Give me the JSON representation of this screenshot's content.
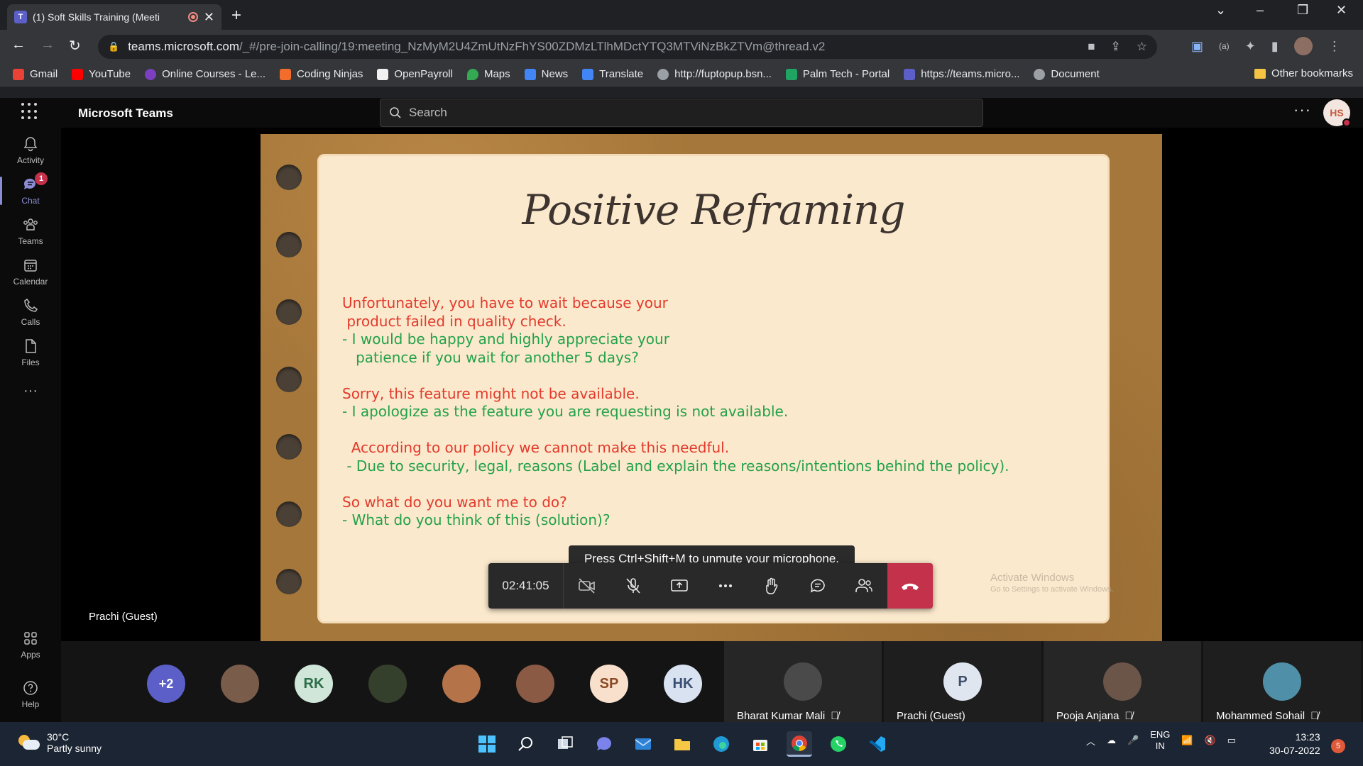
{
  "browser": {
    "tab_title": "(1) Soft Skills Training (Meeti",
    "url_host": "teams.microsoft.com",
    "url_path": "/_#/pre-join-calling/19:meeting_NzMyM2U4ZmUtNzFhYS00ZDMzLTlhMDctYTQ3MTViNzBkZTVm@thread.v2",
    "bookmarks": [
      "Gmail",
      "YouTube",
      "Online Courses - Le...",
      "Coding Ninjas",
      "OpenPayroll",
      "Maps",
      "News",
      "Translate",
      "http://fuptopup.bsn...",
      "Palm Tech - Portal",
      "https://teams.micro...",
      "Document"
    ],
    "other_bookmarks": "Other bookmarks"
  },
  "teams": {
    "app_title": "Microsoft Teams",
    "search_placeholder": "Search",
    "user_initials": "HS",
    "rail": [
      {
        "label": "Activity"
      },
      {
        "label": "Chat",
        "badge": "1"
      },
      {
        "label": "Teams"
      },
      {
        "label": "Calendar"
      },
      {
        "label": "Calls"
      },
      {
        "label": "Files"
      },
      {
        "label": "Apps"
      },
      {
        "label": "Help"
      }
    ]
  },
  "slide": {
    "title": "Positive Reframing",
    "lines": [
      {
        "text": "Unfortunately, you have to wait because your",
        "color": "red"
      },
      {
        "text": " product failed in quality check.",
        "color": "red"
      },
      {
        "text": "- I would be happy and highly appreciate your",
        "color": "green"
      },
      {
        "text": "   patience if you wait for another 5 days?",
        "color": "green"
      },
      {
        "text": "",
        "color": "red"
      },
      {
        "text": "Sorry, this feature might not be available.",
        "color": "red"
      },
      {
        "text": "- I apologize as the feature you are requesting is not available.",
        "color": "green"
      },
      {
        "text": "",
        "color": "red"
      },
      {
        "text": "  According to our policy we cannot make this needful.",
        "color": "red"
      },
      {
        "text": " - Due to security, legal, reasons (Label and explain the reasons/intentions behind the policy).",
        "color": "green"
      },
      {
        "text": "",
        "color": "red"
      },
      {
        "text": "So what do you want me to do?",
        "color": "red"
      },
      {
        "text": "- What do you think of this (solution)?",
        "color": "green"
      }
    ],
    "watermark_title": "Activate Windows",
    "watermark_sub": "Go to Settings to activate Windows."
  },
  "call": {
    "tooltip": "Press Ctrl+Shift+M to unmute your microphone.",
    "timer": "02:41:05",
    "presenter_label": "Prachi (Guest)"
  },
  "participants": {
    "overflow": "+2",
    "avatars": [
      {
        "initials": "",
        "kind": "photo"
      },
      {
        "initials": "RK",
        "kind": "initials"
      },
      {
        "initials": "",
        "kind": "photo"
      },
      {
        "initials": "",
        "kind": "photo"
      },
      {
        "initials": "",
        "kind": "photo"
      },
      {
        "initials": "SP",
        "kind": "initials"
      },
      {
        "initials": "HK",
        "kind": "initials"
      }
    ],
    "tiles": [
      {
        "name": "Bharat Kumar Mali",
        "initials": "",
        "muted": true
      },
      {
        "name": "Prachi (Guest)",
        "initials": "P",
        "muted": false
      },
      {
        "name": "Pooja Anjana",
        "initials": "",
        "muted": true
      },
      {
        "name": "Mohammed Sohail",
        "initials": "",
        "muted": true
      }
    ]
  },
  "taskbar": {
    "temperature": "30°C",
    "weather": "Partly sunny",
    "lang": "ENG",
    "region": "IN",
    "time": "13:23",
    "date": "30-07-2022",
    "notifications": "5"
  },
  "colors": {
    "teams_accent": "#8b8cd6",
    "hangup": "#c4314b",
    "slide_red": "#e23a2b",
    "slide_green": "#22a14a"
  }
}
